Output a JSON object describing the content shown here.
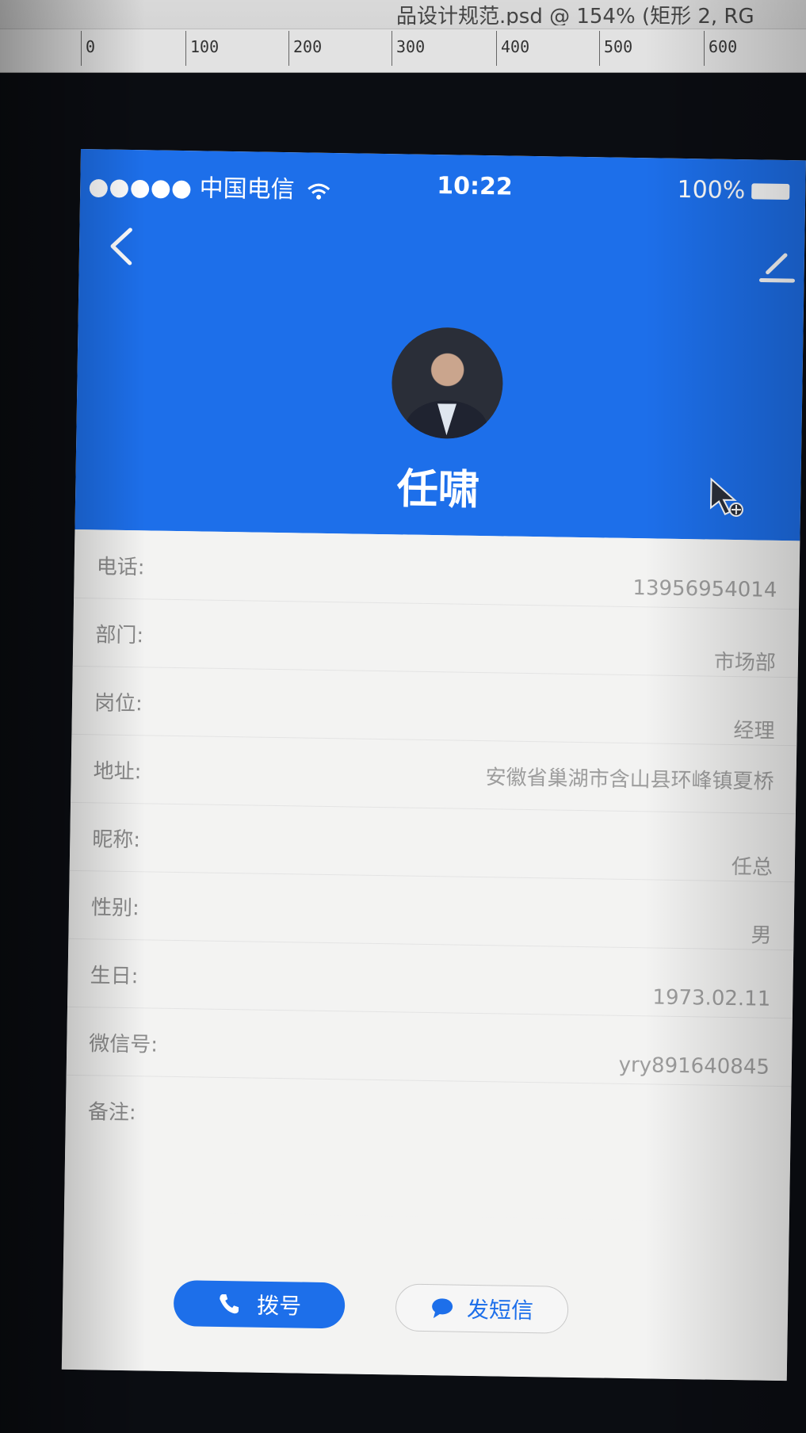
{
  "app": {
    "title": "品设计规范.psd @ 154% (矩形 2, RG",
    "ruler_ticks": [
      "0",
      "100",
      "200",
      "300",
      "400",
      "500",
      "600"
    ]
  },
  "status_bar": {
    "carrier": "●●●●● 中国电信",
    "time": "10:22",
    "battery": "100%"
  },
  "profile": {
    "name": "任啸"
  },
  "fields": [
    {
      "label": "电话:",
      "value": "13956954014"
    },
    {
      "label": "部门:",
      "value": "市场部"
    },
    {
      "label": "岗位:",
      "value": "经理"
    },
    {
      "label": "地址:",
      "value": "安徽省巢湖市含山县环峰镇夏桥"
    },
    {
      "label": "昵称:",
      "value": "任总"
    },
    {
      "label": "性别:",
      "value": "男"
    },
    {
      "label": "生日:",
      "value": "1973.02.11"
    },
    {
      "label": "微信号:",
      "value": "yry891640845"
    },
    {
      "label": "备注:",
      "value": ""
    }
  ],
  "actions": {
    "call_label": "拨号",
    "sms_label": "发短信"
  },
  "colors": {
    "accent": "#1d6fea",
    "background": "#f3f3f2"
  },
  "icons": {
    "back": "back-arrow-icon",
    "edit": "edit-pencil-icon",
    "wifi": "wifi-icon",
    "phone": "phone-icon",
    "message": "message-icon",
    "cursor": "move-cursor-icon"
  }
}
